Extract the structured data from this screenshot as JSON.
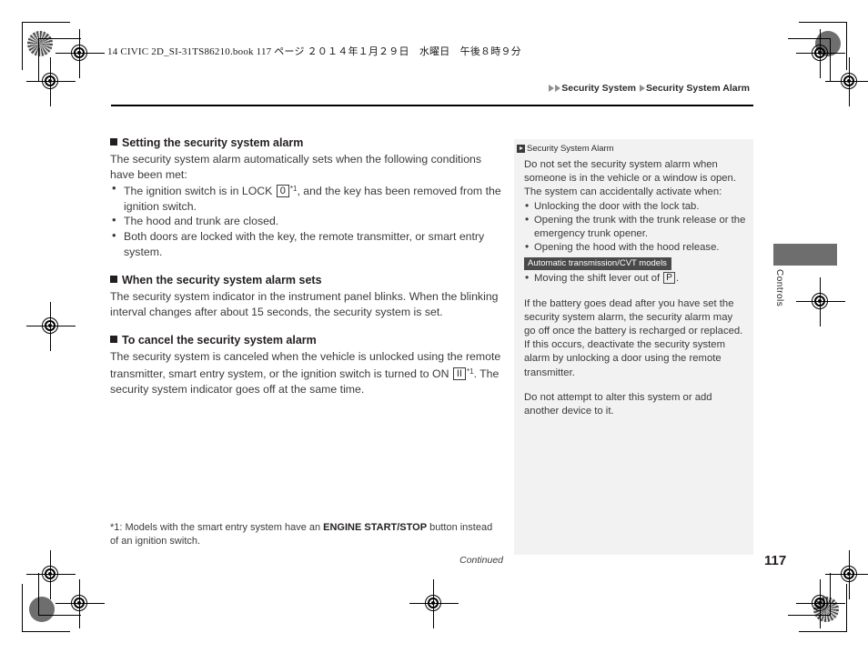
{
  "file_info": "14 CIVIC 2D_SI-31TS86210.book  117 ページ  ２０１４年１月２９日　水曜日　午後８時９分",
  "running_head": {
    "parent": "Security System",
    "current": "Security System Alarm"
  },
  "main": {
    "sections": [
      {
        "heading": "Setting the security system alarm",
        "intro": "The security system alarm automatically sets when the following conditions have been met:",
        "bullets": [
          {
            "pre": "The ignition switch is in LOCK ",
            "key": "0",
            "sup": "*1",
            "post": ", and the key has been removed from the ignition switch."
          },
          {
            "pre": "The hood and trunk are closed.",
            "key": "",
            "sup": "",
            "post": ""
          },
          {
            "pre": "Both doors are locked with the key, the remote transmitter, or smart entry system.",
            "key": "",
            "sup": "",
            "post": ""
          }
        ]
      },
      {
        "heading": "When the security system alarm sets",
        "intro": "The security system indicator in the instrument panel blinks. When the blinking interval changes after about 15 seconds, the security system is set.",
        "bullets": []
      },
      {
        "heading": "To cancel the security system alarm",
        "intro_pre": "The security system is canceled when the vehicle is unlocked using the remote transmitter, smart entry system, or the ignition switch is turned to ON ",
        "intro_key": "II",
        "intro_sup": "*1",
        "intro_post": ". The security system indicator goes off at the same time.",
        "bullets": []
      }
    ]
  },
  "footnote": {
    "prefix": "*1: Models with the smart entry system have an ",
    "bold": "ENGINE START/STOP",
    "suffix": " button instead of an ignition switch."
  },
  "continued_label": "Continued",
  "side_panel": {
    "title": "Security System Alarm",
    "para1": "Do not set the security system alarm when someone is in the vehicle or a window is open. The system can accidentally activate when:",
    "bullets": [
      "Unlocking the door with the lock tab.",
      "Opening the trunk with the trunk release or the emergency trunk opener.",
      "Opening the hood with the hood release."
    ],
    "model_tag": "Automatic transmission/CVT models",
    "shift_bullet_pre": "Moving the shift lever out of ",
    "shift_bullet_key": "P",
    "shift_bullet_post": ".",
    "para2": "If the battery goes dead after you have set the security system alarm, the security alarm may go off once the battery is recharged or replaced.",
    "para3": "If this occurs, deactivate the security system alarm by unlocking a door using the remote transmitter.",
    "para4": "Do not attempt to alter this system or add another device to it."
  },
  "thumb_tab_label": "Controls",
  "page_number": "117",
  "colors": {
    "panel_bg": "#f2f2f2",
    "tab_gray": "#6e6e6e",
    "model_tag_bg": "#4a4a4a",
    "text": "#3a3a3a"
  }
}
